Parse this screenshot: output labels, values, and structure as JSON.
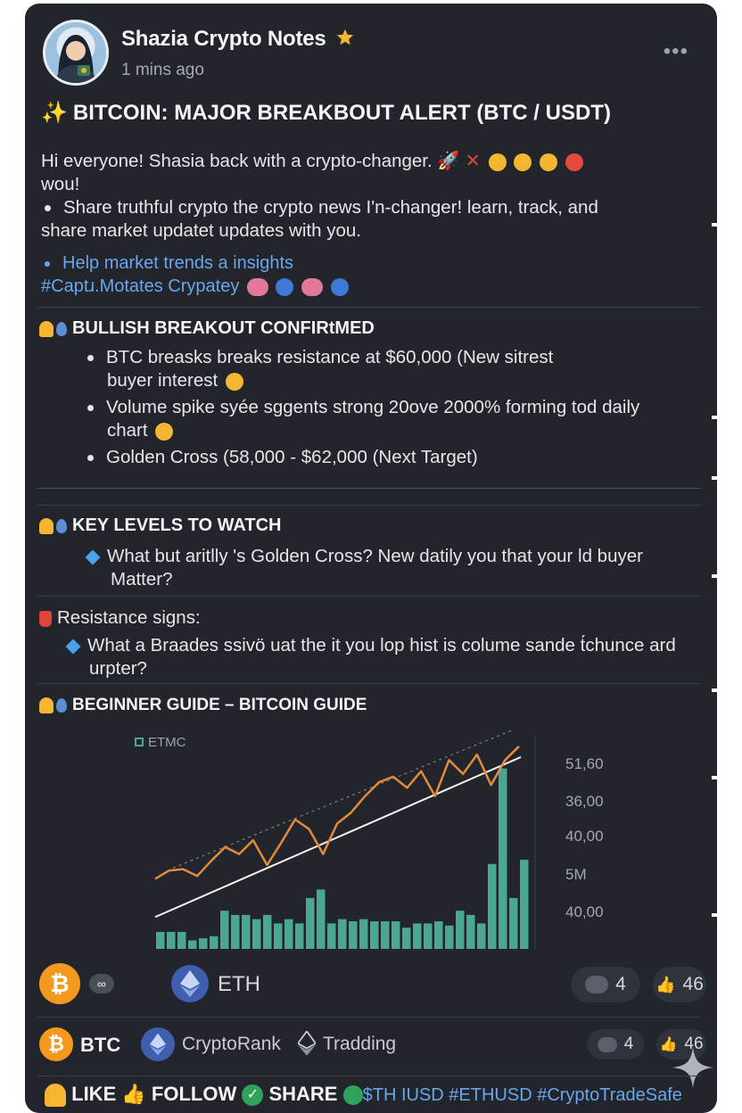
{
  "post": {
    "author": "Shazia Crypto Notes",
    "timestamp": "1 mins ago",
    "title": "BITCOIN: MAJOR BREAKBOUT ALERT (BTC / USDT)",
    "intro_line1": "Hi everyone! Shasia back with a crypto-changer.",
    "intro_line2": "wou!",
    "intro_line3": "Share truthful crypto the crypto news I'n-changer! learn, track, and",
    "intro_line4": "share market updatet updates with you.",
    "help_link": "Help market trends a insights",
    "hashtags": "#Captɹ.Motates Crypatey"
  },
  "sections": {
    "bullish": {
      "heading": "BULLISH BREAKOUT CONFIRtMED",
      "b1_line1": "BTC breasks breaks resistance at $60,000 (New sitrest",
      "b1_line2": "buyer interest",
      "b2_line1": "Volume spike syée sggents strong 20ove 2000% forming tod daily",
      "b2_line2": "chart",
      "b3": "Golden Cross (58,000 - $62,000 (Next Target)"
    },
    "key_levels": {
      "heading": "KEY LEVELS TO WATCH",
      "q_line1": "What but aritlly 's Golden Cross? New datily you that your ld buyer",
      "q_line2": "Matter?"
    },
    "resistance": {
      "heading": "Resistance signs:",
      "q_line1": "What a Braades ssivö uat the it you lop hist is colume sande t́chunce ard",
      "q_line2": "urpter?"
    },
    "guide": {
      "heading": "BEGINNER GUIDE – BITCOIN GUIDE"
    }
  },
  "chart_data": {
    "type": "line",
    "legend": "ETMC",
    "y_tick_labels": [
      "51,60",
      "36,00",
      "40,00",
      "5M",
      "40,00"
    ],
    "price_series": [
      12,
      18,
      19,
      14,
      25,
      35,
      30,
      40,
      22,
      38,
      55,
      48,
      30,
      52,
      60,
      72,
      82,
      86,
      78,
      90,
      72,
      98,
      88,
      102,
      80,
      98,
      108
    ],
    "trend_series_start": 5,
    "trend_series_end": 95,
    "volume_series": [
      8,
      8,
      8,
      4,
      5,
      6,
      18,
      16,
      16,
      14,
      16,
      12,
      14,
      12,
      24,
      28,
      12,
      14,
      13,
      14,
      13,
      13,
      13,
      10,
      12,
      12,
      13,
      11,
      18,
      16,
      12,
      40,
      85,
      24,
      42
    ]
  },
  "reactions_row1": {
    "coin_label": "ETH",
    "comments": "4",
    "likes": "46"
  },
  "reactions_row2": {
    "btc_label": "BTC",
    "cryptorank_label": "CryptoRank",
    "trading_label": "Tradding",
    "comments": "4",
    "likes": "46"
  },
  "footer": {
    "like": "LIKE",
    "follow": "FOLLOW",
    "share": "SHARE",
    "tags": "$TH IUSD #ETHUSD #CryptoTradeSafe"
  },
  "colors": {
    "card_bg": "#22252c",
    "accent_link": "#6aa6ea",
    "price_line": "#e48a3c",
    "volume_bar": "#48a890",
    "bitcoin": "#f39a1e",
    "ethereum": "#5a7fd6"
  }
}
